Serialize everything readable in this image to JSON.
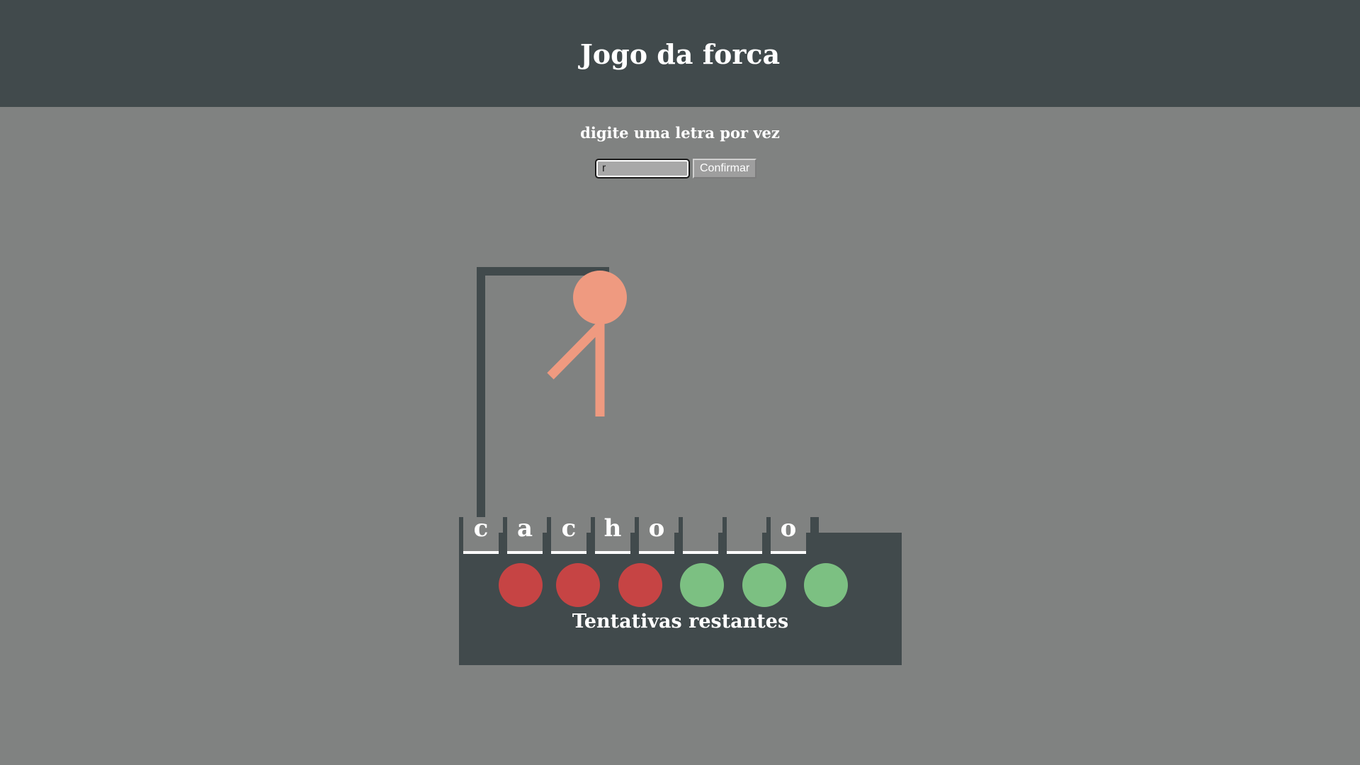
{
  "header": {
    "title": "Jogo da forca"
  },
  "instruction": "digite uma letra por vez",
  "input": {
    "value": "r",
    "placeholder": ""
  },
  "confirm_label": "Confirmar",
  "word": {
    "slots": [
      "c",
      "a",
      "c",
      "h",
      "o",
      "",
      "",
      "o"
    ]
  },
  "attempts": {
    "label": "Tentativas restantes",
    "used": 3,
    "remaining": 3,
    "used_color": "#c64444",
    "remaining_color": "#7cc082"
  },
  "hangman": {
    "body_parts_shown": [
      "head",
      "torso",
      "left-arm"
    ],
    "color": "#ef9a80",
    "gallows_color": "#414a4c"
  },
  "colors": {
    "header_bg": "#414a4c",
    "page_bg": "#808281",
    "board_bg": "#414a4c",
    "text": "#ffffff"
  }
}
